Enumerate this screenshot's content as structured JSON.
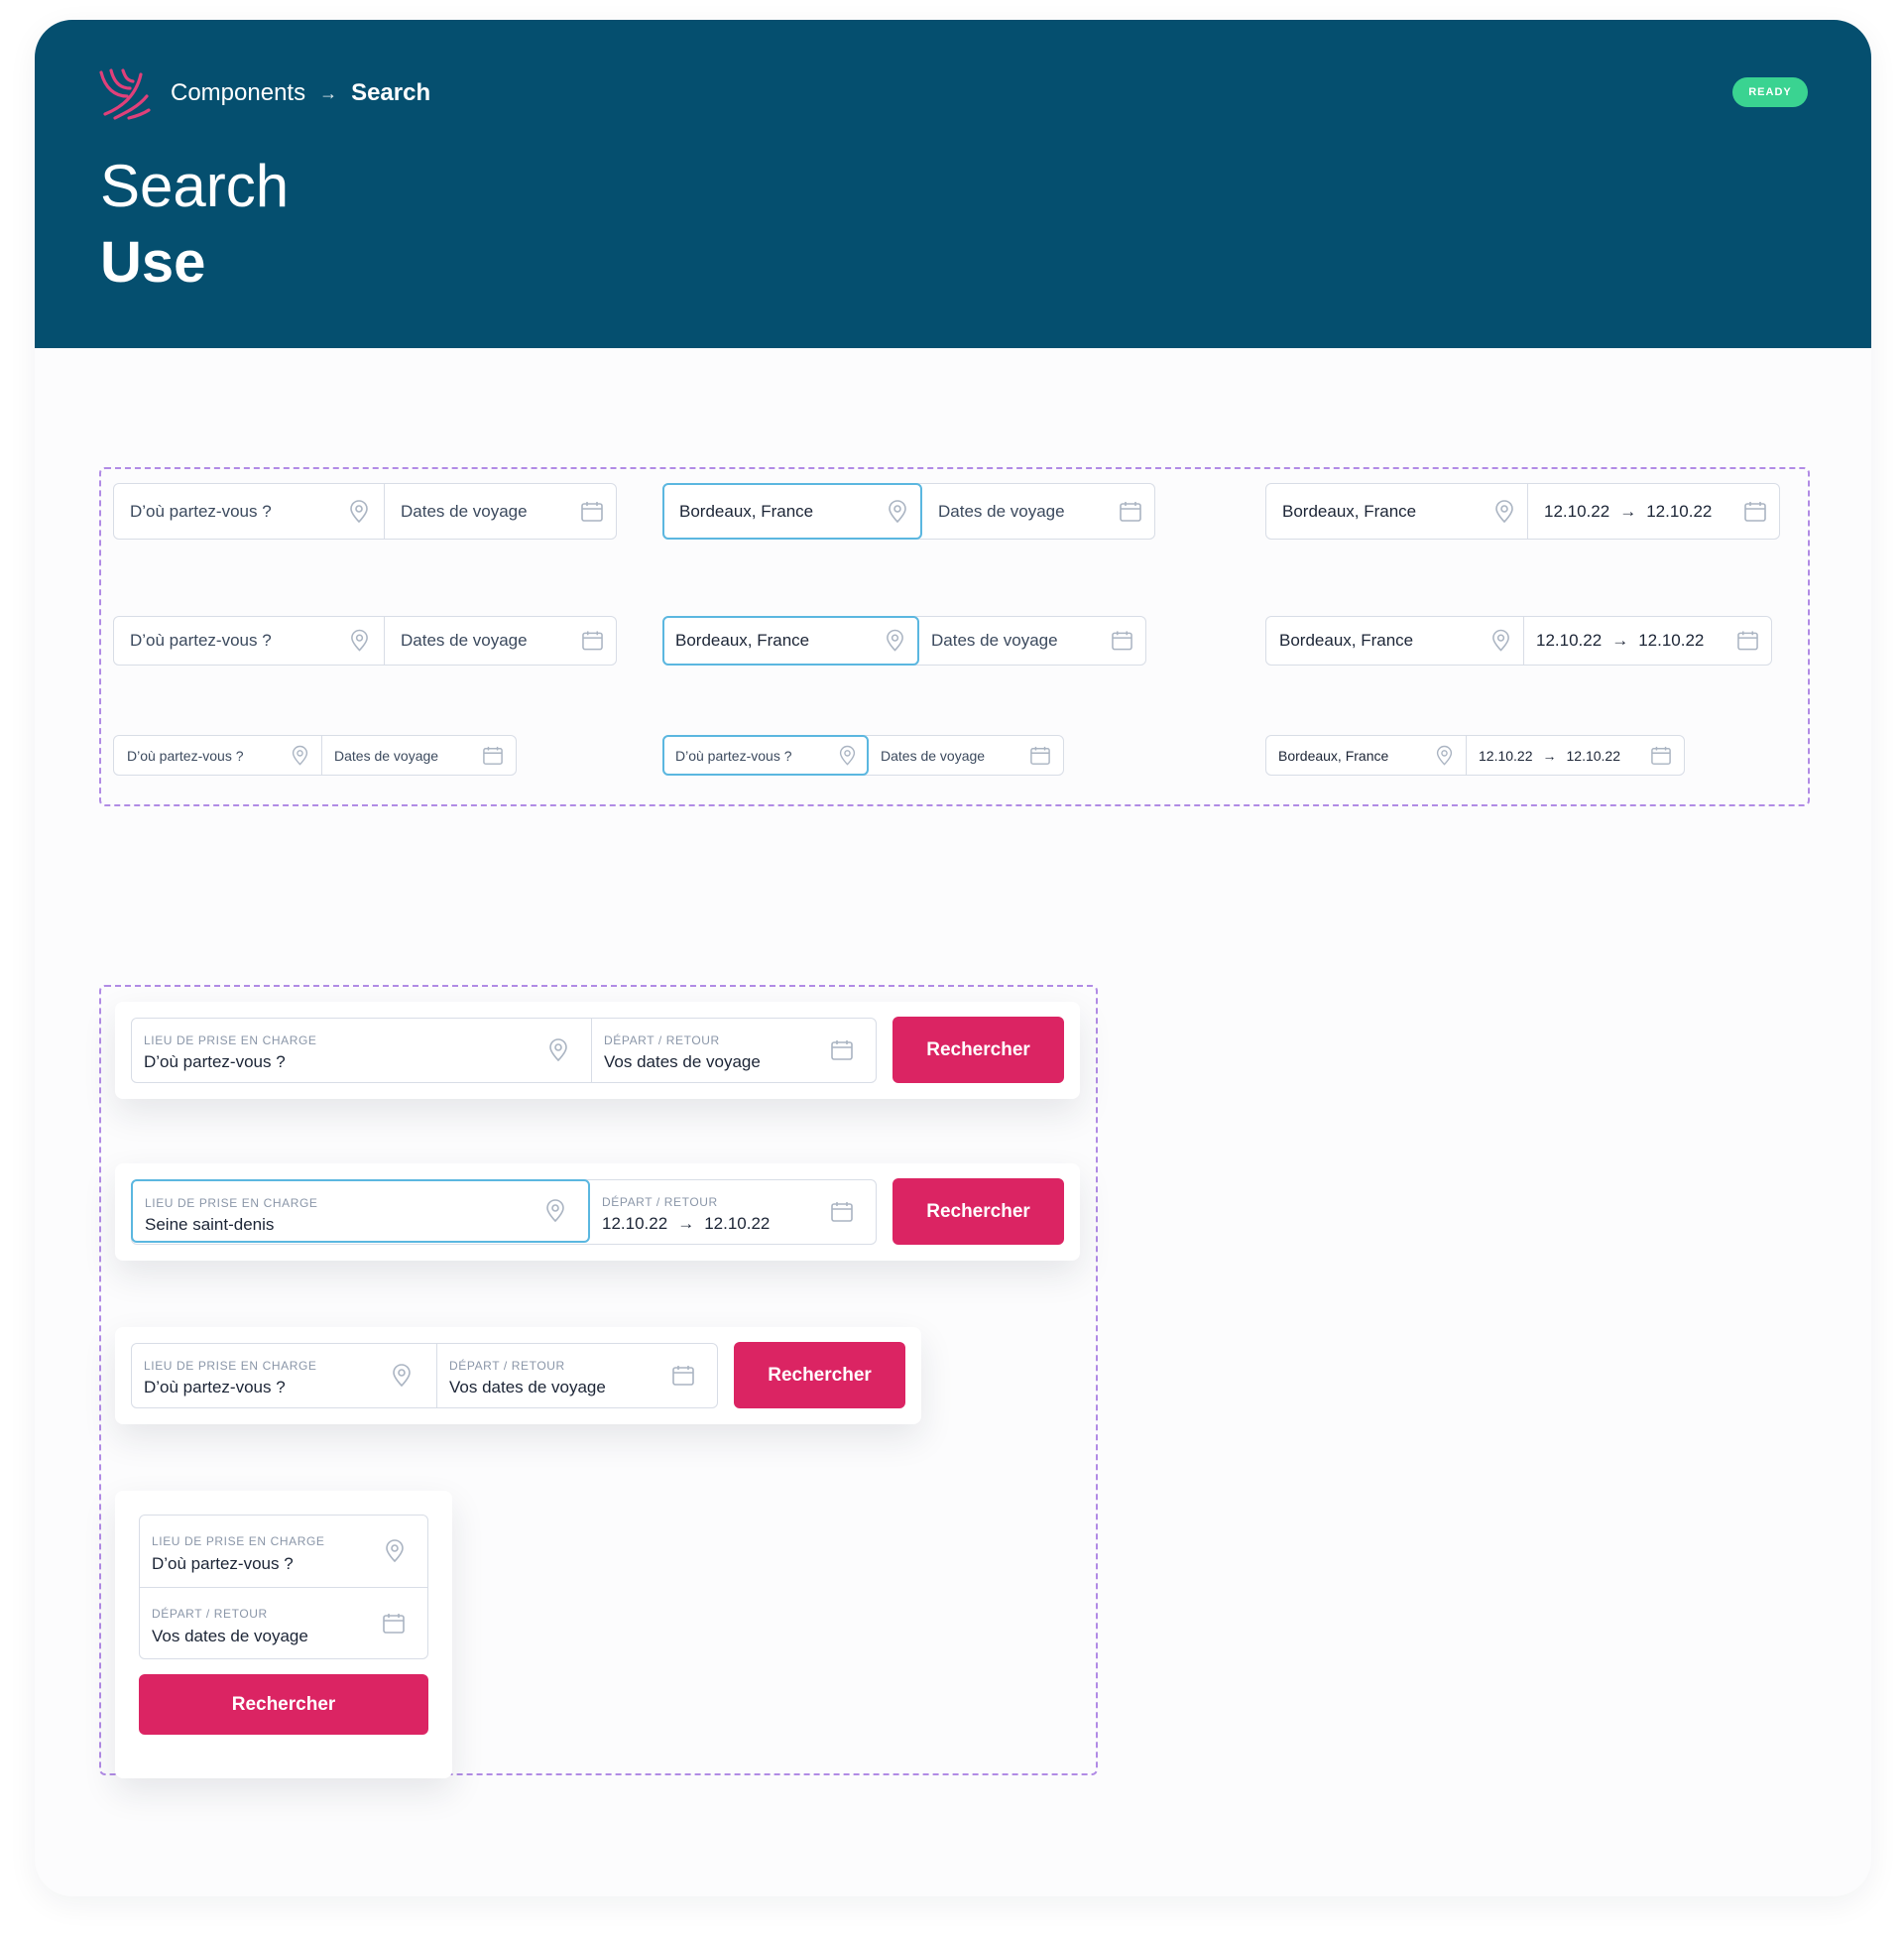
{
  "header": {
    "breadcrumb": {
      "parent": "Components",
      "separator": "→",
      "current": "Search"
    },
    "badge": "READY",
    "title": "Search",
    "subtitle": "Use"
  },
  "colors": {
    "header_bg": "#054f6f",
    "badge_bg": "#3ad391",
    "logo": "#e0407a",
    "focus_border": "#5bb7e0",
    "button_bg": "#db2463",
    "frame_dashed": "#b18be5"
  },
  "icons": {
    "location": "map-pin-icon",
    "dates": "calendar-icon",
    "arrow": "arrow-right-icon"
  },
  "compact_bars": {
    "large": [
      {
        "location": "D’où partez-vous ?",
        "dates": "Dates de voyage"
      },
      {
        "location": "Bordeaux, France",
        "dates": "Dates de voyage"
      },
      {
        "location": "Bordeaux, France",
        "date_start": "12.10.22",
        "date_end": "12.10.22"
      }
    ],
    "medium": [
      {
        "location": "D’où partez-vous ?",
        "dates": "Dates de voyage"
      },
      {
        "location": "Bordeaux, France",
        "dates": "Dates de voyage"
      },
      {
        "location": "Bordeaux, France",
        "date_start": "12.10.22",
        "date_end": "12.10.22"
      }
    ],
    "small": [
      {
        "location": "D’où partez-vous ?",
        "dates": "Dates de voyage"
      },
      {
        "location": "D’où partez-vous ?",
        "dates": "Dates de voyage"
      },
      {
        "location": "Bordeaux, France",
        "date_start": "12.10.22",
        "date_end": "12.10.22"
      }
    ]
  },
  "full_bars": {
    "location_label": "LIEU DE PRISE EN CHARGE",
    "dates_label": "DÉPART / RETOUR",
    "button_label": "Rechercher",
    "bar1": {
      "location": "D’où partez-vous ?",
      "dates": "Vos dates de voyage"
    },
    "bar2": {
      "location": "Seine saint-denis",
      "date_start": "12.10.22",
      "date_end": "12.10.22"
    },
    "bar3": {
      "location": "D’où partez-vous ?",
      "dates": "Vos dates de voyage"
    },
    "bar4": {
      "location": "D’où partez-vous ?",
      "dates": "Vos dates de voyage"
    }
  }
}
